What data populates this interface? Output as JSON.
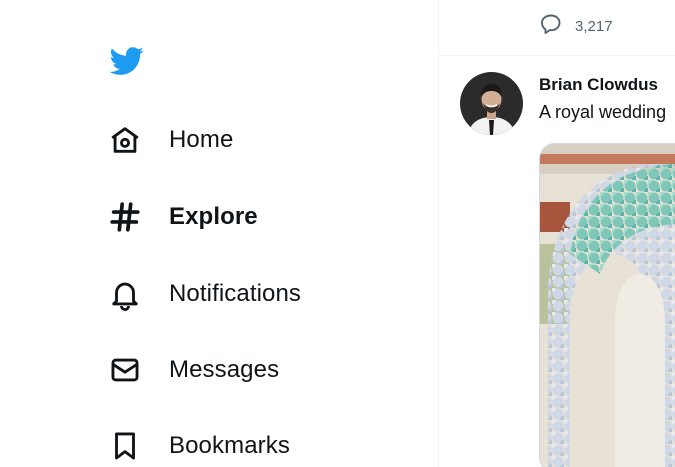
{
  "nav": {
    "items": [
      {
        "label": "Home",
        "icon": "home-icon"
      },
      {
        "label": "Explore",
        "icon": "hashtag-icon",
        "active": true
      },
      {
        "label": "Notifications",
        "icon": "bell-icon"
      },
      {
        "label": "Messages",
        "icon": "envelope-icon"
      },
      {
        "label": "Bookmarks",
        "icon": "bookmark-icon"
      }
    ]
  },
  "brand": {
    "icon": "twitter-bird-icon",
    "color": "#1d9bf0"
  },
  "previous_tweet": {
    "reply_count": "3,217",
    "reply_icon": "reply-icon"
  },
  "tweet": {
    "author": "Brian Clowdus",
    "text": "A royal wedding",
    "avatar_icon": "avatar",
    "media": "flower-arch-photo"
  },
  "colors": {
    "text": "#0f1419",
    "secondary": "#536471",
    "accent": "#1d9bf0",
    "border": "#eff3f4"
  }
}
